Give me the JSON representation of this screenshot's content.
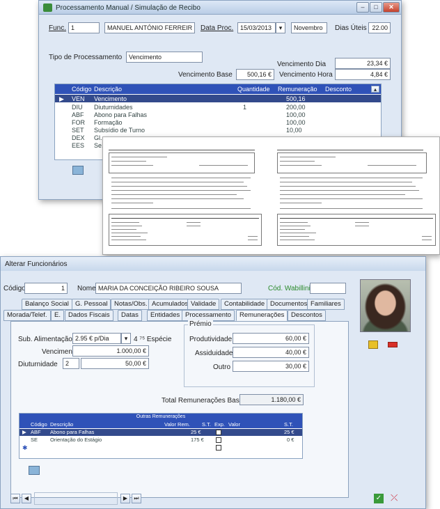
{
  "window1": {
    "title": "Processamento Manual / Simulação de Recibo",
    "func_label": "Func.",
    "func_value": "1",
    "func_name": "MANUEL ANTÓNIO FERREIR",
    "data_proc_label": "Data Proc.",
    "data_proc_value": "15/03/2013",
    "month": "Novembro",
    "dias_uteis_label": "Dias Úteis",
    "dias_uteis_value": "22.00",
    "tipo_label": "Tipo de Processamento",
    "tipo_value": "Vencimento",
    "venc_dia_label": "Vencimento Dia",
    "venc_dia_value": "23,34 €",
    "venc_base_label": "Vencimento Base",
    "venc_base_value": "500,16 €",
    "venc_hora_label": "Vencimento Hora",
    "venc_hora_value": "4,84 €",
    "grid_headers": [
      "Código",
      "Descrição",
      "Quantidade",
      "Remuneração",
      "Desconto"
    ],
    "rows": [
      {
        "code": "VEN",
        "desc": "Vencimento",
        "qty": "",
        "rem": "500,16"
      },
      {
        "code": "DIU",
        "desc": "Diuturnidades",
        "qty": "1",
        "rem": "200,00"
      },
      {
        "code": "ABF",
        "desc": "Abono para Falhas",
        "qty": "",
        "rem": "100,00"
      },
      {
        "code": "FOR",
        "desc": "Formação",
        "qty": "",
        "rem": "100,00"
      },
      {
        "code": "SET",
        "desc": "Subsídio de Turno",
        "qty": "",
        "rem": "10,00"
      },
      {
        "code": "DEX",
        "desc": "Gl...",
        "qty": "",
        "rem": ""
      },
      {
        "code": "EES",
        "desc": "Se...",
        "qty": "",
        "rem": ""
      }
    ]
  },
  "window3": {
    "title": "Alterar Funcionários",
    "codigo_label": "Código",
    "codigo_value": "1",
    "nome_label": "Nome",
    "nome_value": "MARIA DA CONCEIÇÃO RIBEIRO SOUSA",
    "cod_label": "Cód. Wabillini",
    "tabs_row1": [
      "Balanço Social",
      "G. Pessoal",
      "Notas/Obs.",
      "Acumulados",
      "Validade",
      "Contabilidade",
      "Documentos",
      "Familiares"
    ],
    "tabs_row2": [
      "Morada/Telef.",
      "E.",
      "Dados Fiscais",
      "Datas",
      "Entidades",
      "Processamento",
      "Remunerações",
      "Descontos"
    ],
    "sub_alim_label": "Sub. Alimentação",
    "sub_alim_value": "2.95 € p/Dia",
    "vencimento_label": "Vencimento",
    "vencimento_value": "1.000,00 €",
    "diut_label": "Diuturnidade",
    "diut_qty": "2",
    "diut_value": "50,00 €",
    "premio_label": "Prémio",
    "prod_label": "Produtividade",
    "prod_value": "60,00 €",
    "assid_label": "Assiduidade",
    "assid_value": "40,00 €",
    "outro_label": "Outro",
    "outro_value": "30,00 €",
    "total_label": "Total Remunerações Base",
    "total_value": "1.180,00 €",
    "outras_title": "Outras Remunerações",
    "grid_headers": [
      "Código",
      "Descrição",
      "Valor Rem.",
      "S.T.",
      "Exp.",
      "Valor",
      "S.T."
    ],
    "rows": [
      {
        "code": "ABF",
        "desc": "Abono para Falhas",
        "val": "25 €",
        "val2": "25 €"
      },
      {
        "code": "SE",
        "desc": "Orientação do Estágio",
        "val": "175 €",
        "val2": "0 €"
      }
    ]
  }
}
